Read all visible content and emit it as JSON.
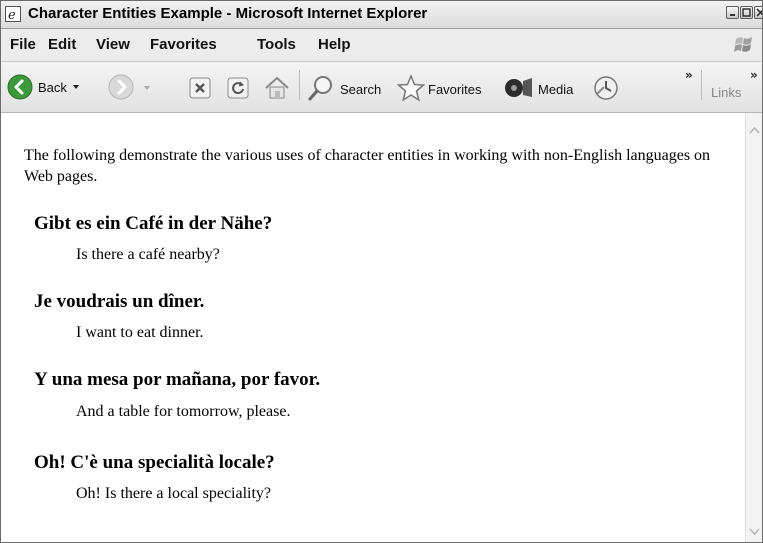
{
  "window": {
    "title": "Character Entities Example - Microsoft Internet Explorer"
  },
  "menubar": {
    "items": [
      "File",
      "Edit",
      "View",
      "Favorites",
      "Tools",
      "Help"
    ]
  },
  "toolbar": {
    "back_label": "Back",
    "search_label": "Search",
    "favorites_label": "Favorites",
    "media_label": "Media",
    "links_label": "Links",
    "overflow_glyph": "»"
  },
  "content": {
    "intro": "The following demonstrate the various uses of character entities in working with non-English languages on Web pages.",
    "sections": [
      {
        "heading": "Gibt es ein Café in der Nähe?",
        "translation": "Is there a café nearby?"
      },
      {
        "heading": "Je voudrais un dîner.",
        "translation": "I want to eat dinner."
      },
      {
        "heading": "Y una mesa por mañana, por favor.",
        "translation": "And a table for tomorrow, please."
      },
      {
        "heading": "Oh! C'è una specialità locale?",
        "translation": "Oh! Is there a local speciality?"
      }
    ]
  },
  "colors": {
    "titlebar": "#dcdcdc",
    "toolbar": "#e8e8e8",
    "back_green": "#3c9a3c",
    "page_bg": "#ffffff"
  },
  "icons": [
    "ie-icon",
    "minimize-icon",
    "maximize-icon",
    "close-icon",
    "windows-logo-icon",
    "back-icon",
    "forward-icon",
    "stop-icon",
    "refresh-icon",
    "home-icon",
    "search-icon",
    "favorites-star-icon",
    "media-icon",
    "history-icon"
  ]
}
